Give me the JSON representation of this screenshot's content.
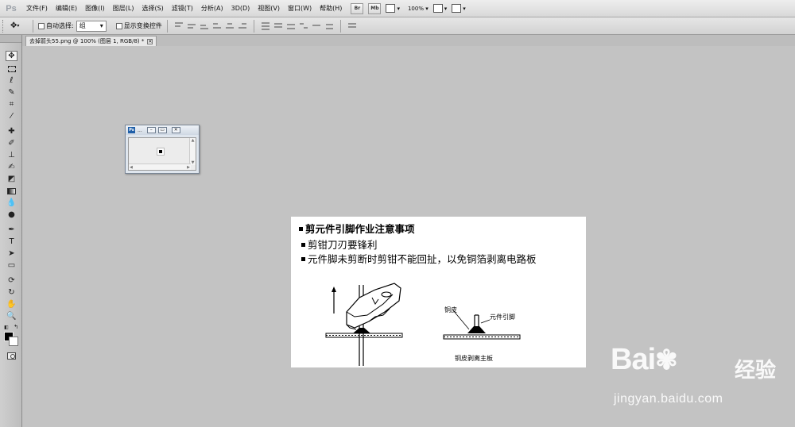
{
  "app": {
    "logo": "Ps"
  },
  "menu": [
    "文件(F)",
    "编辑(E)",
    "图像(I)",
    "图层(L)",
    "选择(S)",
    "滤镜(T)",
    "分析(A)",
    "3D(D)",
    "视图(V)",
    "窗口(W)",
    "帮助(H)"
  ],
  "appbar": {
    "bridge_label": "Br",
    "minibridge_label": "Mb",
    "zoom": "100%"
  },
  "options": {
    "auto_select_label": "自动选择:",
    "group_value": "组",
    "transform_label": "显示变换控件"
  },
  "document": {
    "tab_title": "去掉箭头55.png @ 100% (图层 1, RGB/8) *",
    "close_glyph": "✕"
  },
  "float_window": {
    "dots": "..."
  },
  "canvas": {
    "title": "剪元件引脚作业注意事项",
    "bullets": [
      "剪钳刀刃要锋利",
      "元件脚未剪断时剪钳不能回扯，以免铜箔剥离电路板"
    ],
    "labels": {
      "copper": "铜皮",
      "lead": "元件引脚",
      "caption": "铜皮剥离主板"
    }
  },
  "watermark": {
    "brand": "Bai",
    "brand_tail": "经验",
    "url": "jingyan.baidu.com"
  },
  "colors": {
    "foreground": "#000000",
    "background": "#ffffff"
  }
}
